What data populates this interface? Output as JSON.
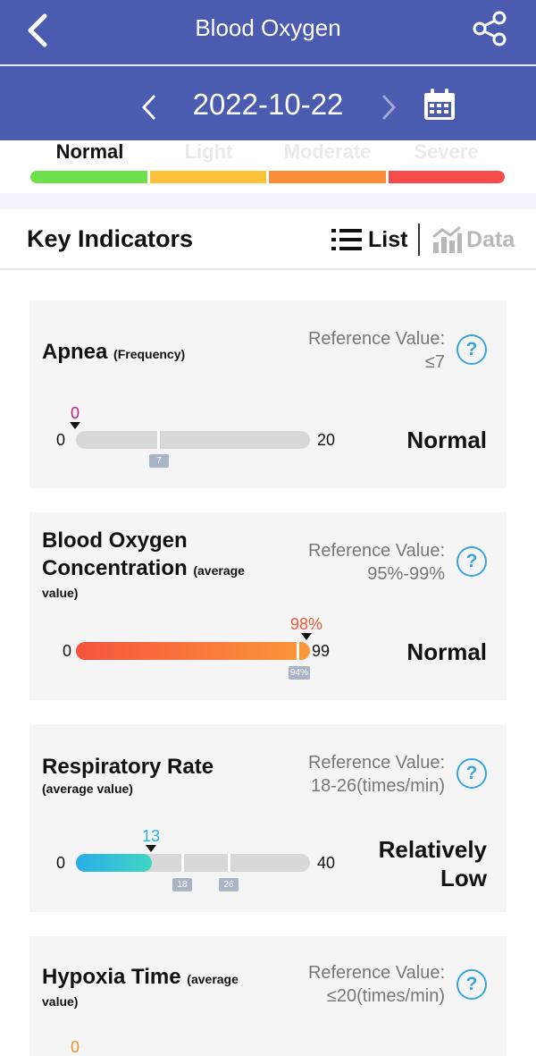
{
  "header": {
    "title": "Blood Oxygen",
    "date": "2022-10-22"
  },
  "severity": {
    "labels": [
      {
        "label": "Normal",
        "color": "#111111"
      },
      {
        "label": "Light",
        "color": "#eaeaea"
      },
      {
        "label": "Moderate",
        "color": "#eaeaea"
      },
      {
        "label": "Severe",
        "color": "#eaeaea"
      }
    ],
    "segment_colors": [
      "#6ee04b",
      "#fcc23a",
      "#fd8c3b",
      "#f54b4b"
    ]
  },
  "indicators": {
    "title": "Key Indicators",
    "list_label": "List",
    "data_label": "Data"
  },
  "cards": [
    {
      "title": "Apnea",
      "subtitle": "(Frequency)",
      "reference_label": "Reference Value:",
      "reference_value": "≤7",
      "min": "0",
      "max": "20",
      "current": "0",
      "current_color": "#c2208c",
      "markers": [
        "7"
      ],
      "status": "Normal"
    },
    {
      "title_line1": "Blood Oxygen",
      "title_line2": "Concentration",
      "subtitle_a": "(average",
      "subtitle_b": "value)",
      "reference_label": "Reference Value:",
      "reference_value": "95%-99%",
      "min": "0",
      "max": "99",
      "current": "98%",
      "current_color": "#ee5a35",
      "markers": [
        "94%"
      ],
      "status": "Normal"
    },
    {
      "title": "Respiratory Rate",
      "subtitle": "(average value)",
      "reference_label": "Reference Value:",
      "reference_value": "18-26(times/min)",
      "min": "0",
      "max": "40",
      "current": "13",
      "current_color": "#2ab1de",
      "markers": [
        "18",
        "26"
      ],
      "status_line1": "Relatively",
      "status_line2": "Low"
    },
    {
      "title": "Hypoxia Time",
      "subtitle_a": "(average",
      "subtitle_b": "value)",
      "reference_label": "Reference Value:",
      "reference_value": "≤20(times/min)",
      "current": "0",
      "current_color": "#f5902f"
    }
  ],
  "help_symbol": "?"
}
